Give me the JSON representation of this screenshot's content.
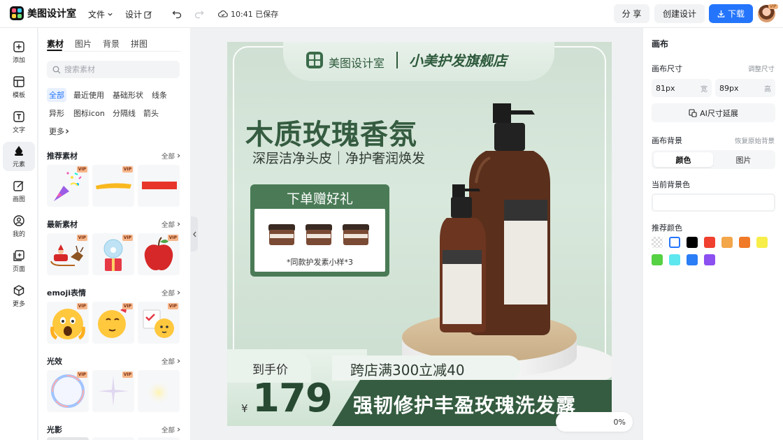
{
  "app": {
    "name": "美图设计室",
    "menu": {
      "file": "文件",
      "design": "设计"
    },
    "saved_status": "10:41 已保存",
    "share_label": "分 享",
    "create_label": "创建设计",
    "download_label": "下载",
    "vip_badge": "VIP",
    "accent_color": "#2475fc"
  },
  "rail": [
    {
      "label": "添加",
      "icon": "plus-square-icon"
    },
    {
      "label": "模板",
      "icon": "template-icon"
    },
    {
      "label": "文字",
      "icon": "text-icon"
    },
    {
      "label": "元素",
      "icon": "shapes-icon",
      "active": true
    },
    {
      "label": "画图",
      "icon": "pen-icon"
    },
    {
      "label": "我的",
      "icon": "user-icon"
    },
    {
      "label": "页面",
      "icon": "add-page-icon"
    },
    {
      "label": "更多",
      "icon": "cube-icon"
    }
  ],
  "panel": {
    "tabs": [
      "素材",
      "图片",
      "背景",
      "拼图"
    ],
    "active_tab": "素材",
    "search_placeholder": "搜索素材",
    "chips": [
      "全部",
      "最近使用",
      "基础形状",
      "线条",
      "异形",
      "图标icon",
      "分隔线",
      "箭头",
      "更多"
    ],
    "active_chip": "全部",
    "sections": [
      {
        "title": "推荐素材",
        "all": "全部"
      },
      {
        "title": "最新素材",
        "all": "全部"
      },
      {
        "title": "emoji表情",
        "all": "全部"
      },
      {
        "title": "光效",
        "all": "全部"
      },
      {
        "title": "光影",
        "all": "全部"
      }
    ],
    "vip_tag": "VIP"
  },
  "poster": {
    "brand": "美图设计室",
    "store": "小美护发旗舰店",
    "title": "木质玫瑰香氛",
    "subtitle": "深层洁净头皮｜净护奢润焕发",
    "gift_title": "下单赠好礼",
    "gift_caption": "*同款护发素小样*3",
    "price_label": "到手价",
    "currency": "¥",
    "price": "179",
    "promo": "跨店满300立减40",
    "product_name": "强韧修护丰盈玫瑰洗发露"
  },
  "zoom": {
    "label": "0%"
  },
  "right": {
    "title": "画布",
    "size_label": "画布尺寸",
    "size_reset": "调整尺寸",
    "width_value": "81px",
    "width_unit": "宽",
    "height_value": "89px",
    "height_unit": "高",
    "ai_extend": "AI尺寸延展",
    "bg_label": "画布背景",
    "bg_reset": "恢复原始背景",
    "seg_color": "颜色",
    "seg_image": "图片",
    "current_bg": "当前背景色",
    "recommended": "推荐颜色",
    "swatches": [
      "transparent",
      "#ffffff",
      "#000000",
      "#f0402f",
      "#f3a64a",
      "#f07a28",
      "#f7ee4a",
      "#56d143",
      "#5ee7ef",
      "#2b7ef5",
      "#8c4ff0"
    ]
  }
}
